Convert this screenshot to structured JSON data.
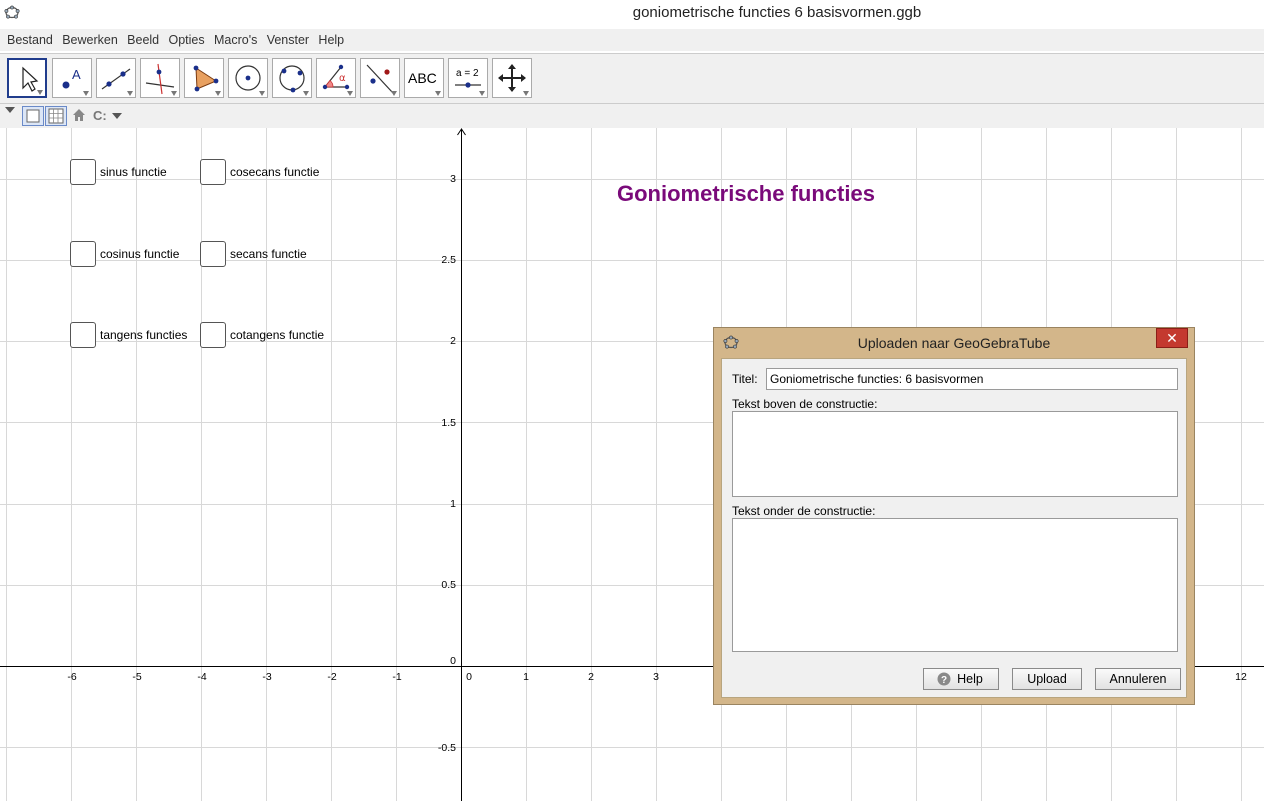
{
  "window": {
    "title": "goniometrische functies 6 basisvormen.ggb"
  },
  "menu": [
    "Bestand",
    "Bewerken",
    "Beeld",
    "Opties",
    "Macro's",
    "Venster",
    "Help"
  ],
  "toolbar": {
    "tools": [
      "move-tool",
      "point-tool",
      "line-tool",
      "perpendicular-line-tool",
      "polygon-tool",
      "circle-tool",
      "conic-tool",
      "angle-tool",
      "reflect-tool",
      "text-tool",
      "slider-tool",
      "move-graphics-view-tool"
    ],
    "text_tool_label": "ABC",
    "slider_tool_label": "a = 2"
  },
  "stylebar": {
    "label": "C:"
  },
  "graphics": {
    "x_ticks": [
      "-6",
      "-5",
      "-4",
      "-3",
      "-2",
      "-1",
      "0",
      "1",
      "2",
      "3",
      "12"
    ],
    "y_ticks": [
      "3",
      "2.5",
      "2",
      "1.5",
      "1",
      "0.5",
      "0",
      "-0.5"
    ],
    "title": "Goniometrische functies",
    "title_color": "#7a0a7a",
    "checkboxes": [
      {
        "label": "sinus functie"
      },
      {
        "label": "cosecans functie"
      },
      {
        "label": "cosinus functie"
      },
      {
        "label": "secans functie"
      },
      {
        "label": "tangens functies"
      },
      {
        "label": "cotangens functie"
      }
    ]
  },
  "dialog": {
    "title": "Uploaden naar GeoGebraTube",
    "close_label": "✕",
    "titel_label": "Titel:",
    "titel_value": "Goniometrische functies: 6 basisvormen",
    "above_label": "Tekst boven de constructie:",
    "above_value": "",
    "below_label": "Tekst onder de constructie:",
    "below_value": "",
    "buttons": {
      "help": "Help",
      "upload": "Upload",
      "cancel": "Annuleren"
    }
  }
}
